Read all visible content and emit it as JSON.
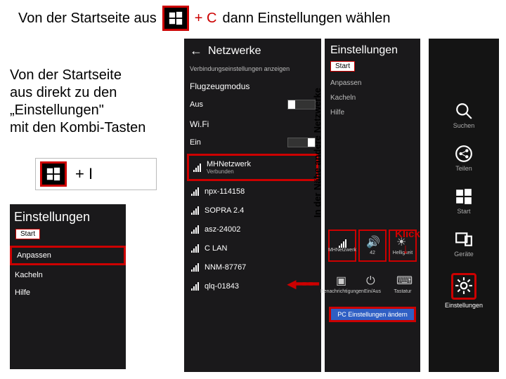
{
  "title": {
    "pre": "Von der Startseite aus",
    "shortcut_c": "+ C",
    "post": "dann Einstellungen wählen"
  },
  "sub": {
    "line1": "Von der Startseite",
    "line2": "aus direkt zu den",
    "line3": "„Einstellungen\"",
    "line4": "mit den Kombi-Tasten",
    "shortcut_i": "+ I"
  },
  "small_panel": {
    "header": "Einstellungen",
    "start": "Start",
    "items": [
      "Anpassen",
      "Kacheln",
      "Hilfe"
    ]
  },
  "net_panel": {
    "header": "Netzwerke",
    "sub": "Verbindungseinstellungen anzeigen",
    "flight_label": "Flugzeugmodus",
    "flight_state": "Aus",
    "wifi_label": "Wi.Fi",
    "wifi_state": "Ein",
    "networks": [
      {
        "name": "MHNetzwerk",
        "status": "Verbunden"
      },
      {
        "name": "npx-114158",
        "status": ""
      },
      {
        "name": "SOPRA 2.4",
        "status": ""
      },
      {
        "name": "asz-24002",
        "status": ""
      },
      {
        "name": "C LAN",
        "status": ""
      },
      {
        "name": "NNM-87767",
        "status": ""
      },
      {
        "name": "qlq-01843",
        "status": ""
      }
    ],
    "side_label": "In der Nähe andere Netzwerke"
  },
  "charm_panel": {
    "header": "Einstellungen",
    "start": "Start",
    "items": [
      "Anpassen",
      "Kacheln",
      "Hilfe"
    ],
    "quick1": [
      {
        "label": "MHNetzwerk",
        "icon": "wifi"
      },
      {
        "label": "42",
        "icon": "vol"
      },
      {
        "label": "Helligkeit",
        "icon": "sun"
      }
    ],
    "quick2": [
      {
        "label": "Benachrichtigungen",
        "icon": "bell"
      },
      {
        "label": "Ein/Aus",
        "icon": "power"
      },
      {
        "label": "Tastatur",
        "icon": "kbd"
      }
    ],
    "pc_settings": "PC Einstellungen ändern"
  },
  "charms": [
    {
      "label": "Suchen",
      "icon": "search"
    },
    {
      "label": "Teilen",
      "icon": "share"
    },
    {
      "label": "Start",
      "icon": "win"
    },
    {
      "label": "Geräte",
      "icon": "devices"
    },
    {
      "label": "Einstellungen",
      "icon": "gear"
    }
  ],
  "annot": {
    "klick": "Klick"
  }
}
